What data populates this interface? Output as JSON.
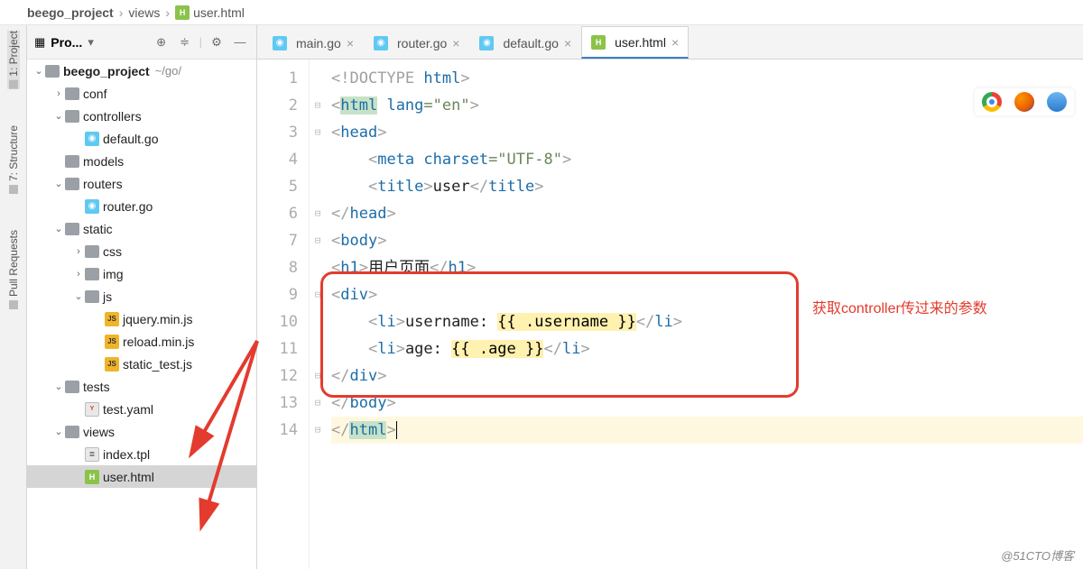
{
  "breadcrumb": {
    "root": "beego_project",
    "mid": "views",
    "file": "user.html"
  },
  "panel": {
    "title": "Pro..."
  },
  "sidebar": {
    "tabs": [
      "1: Project",
      "7: Structure",
      "Pull Requests"
    ]
  },
  "tree": {
    "root": {
      "name": "beego_project",
      "path": "~/go/"
    },
    "items": [
      {
        "name": "conf",
        "type": "folder",
        "arrow": ">",
        "indent": 1
      },
      {
        "name": "controllers",
        "type": "folder",
        "arrow": "v",
        "indent": 1
      },
      {
        "name": "default.go",
        "type": "go",
        "indent": 2
      },
      {
        "name": "models",
        "type": "folder",
        "indent": 1
      },
      {
        "name": "routers",
        "type": "folder",
        "arrow": "v",
        "indent": 1
      },
      {
        "name": "router.go",
        "type": "go",
        "indent": 2
      },
      {
        "name": "static",
        "type": "folder",
        "arrow": "v",
        "indent": 1
      },
      {
        "name": "css",
        "type": "folder",
        "arrow": ">",
        "indent": 2
      },
      {
        "name": "img",
        "type": "folder",
        "arrow": ">",
        "indent": 2
      },
      {
        "name": "js",
        "type": "folder",
        "arrow": "v",
        "indent": 2
      },
      {
        "name": "jquery.min.js",
        "type": "js",
        "indent": 3
      },
      {
        "name": "reload.min.js",
        "type": "js",
        "indent": 3
      },
      {
        "name": "static_test.js",
        "type": "js",
        "indent": 3
      },
      {
        "name": "tests",
        "type": "folder",
        "arrow": "v",
        "indent": 1
      },
      {
        "name": "test.yaml",
        "type": "yml",
        "indent": 2
      },
      {
        "name": "views",
        "type": "folder",
        "arrow": "v",
        "indent": 1
      },
      {
        "name": "index.tpl",
        "type": "tpl",
        "indent": 2
      },
      {
        "name": "user.html",
        "type": "html",
        "indent": 2,
        "selected": true
      }
    ]
  },
  "tabs": [
    {
      "label": "main.go",
      "type": "go"
    },
    {
      "label": "router.go",
      "type": "go"
    },
    {
      "label": "default.go",
      "type": "go"
    },
    {
      "label": "user.html",
      "type": "html",
      "active": true
    }
  ],
  "code": {
    "lines": 14,
    "l1": "<!DOCTYPE html>",
    "l2_tag": "html",
    "l2_attr": "lang",
    "l2_val": "\"en\"",
    "l3": "head",
    "l4_tag": "meta",
    "l4_attr": "charset",
    "l4_val": "\"UTF-8\"",
    "l5_tag": "title",
    "l5_txt": "user",
    "l6": "head",
    "l7": "body",
    "l8_tag": "h1",
    "l8_txt": "用户页面",
    "l9": "div",
    "l10_tag": "li",
    "l10_txt": "username: ",
    "l10_tpl": "{{ .username }}",
    "l11_tag": "li",
    "l11_txt": "age: ",
    "l11_tpl": "{{ .age }}",
    "l12": "div",
    "l13": "body",
    "l14": "html"
  },
  "annotation": {
    "text": "获取controller传过来的参数"
  },
  "watermark": "@51CTO博客"
}
